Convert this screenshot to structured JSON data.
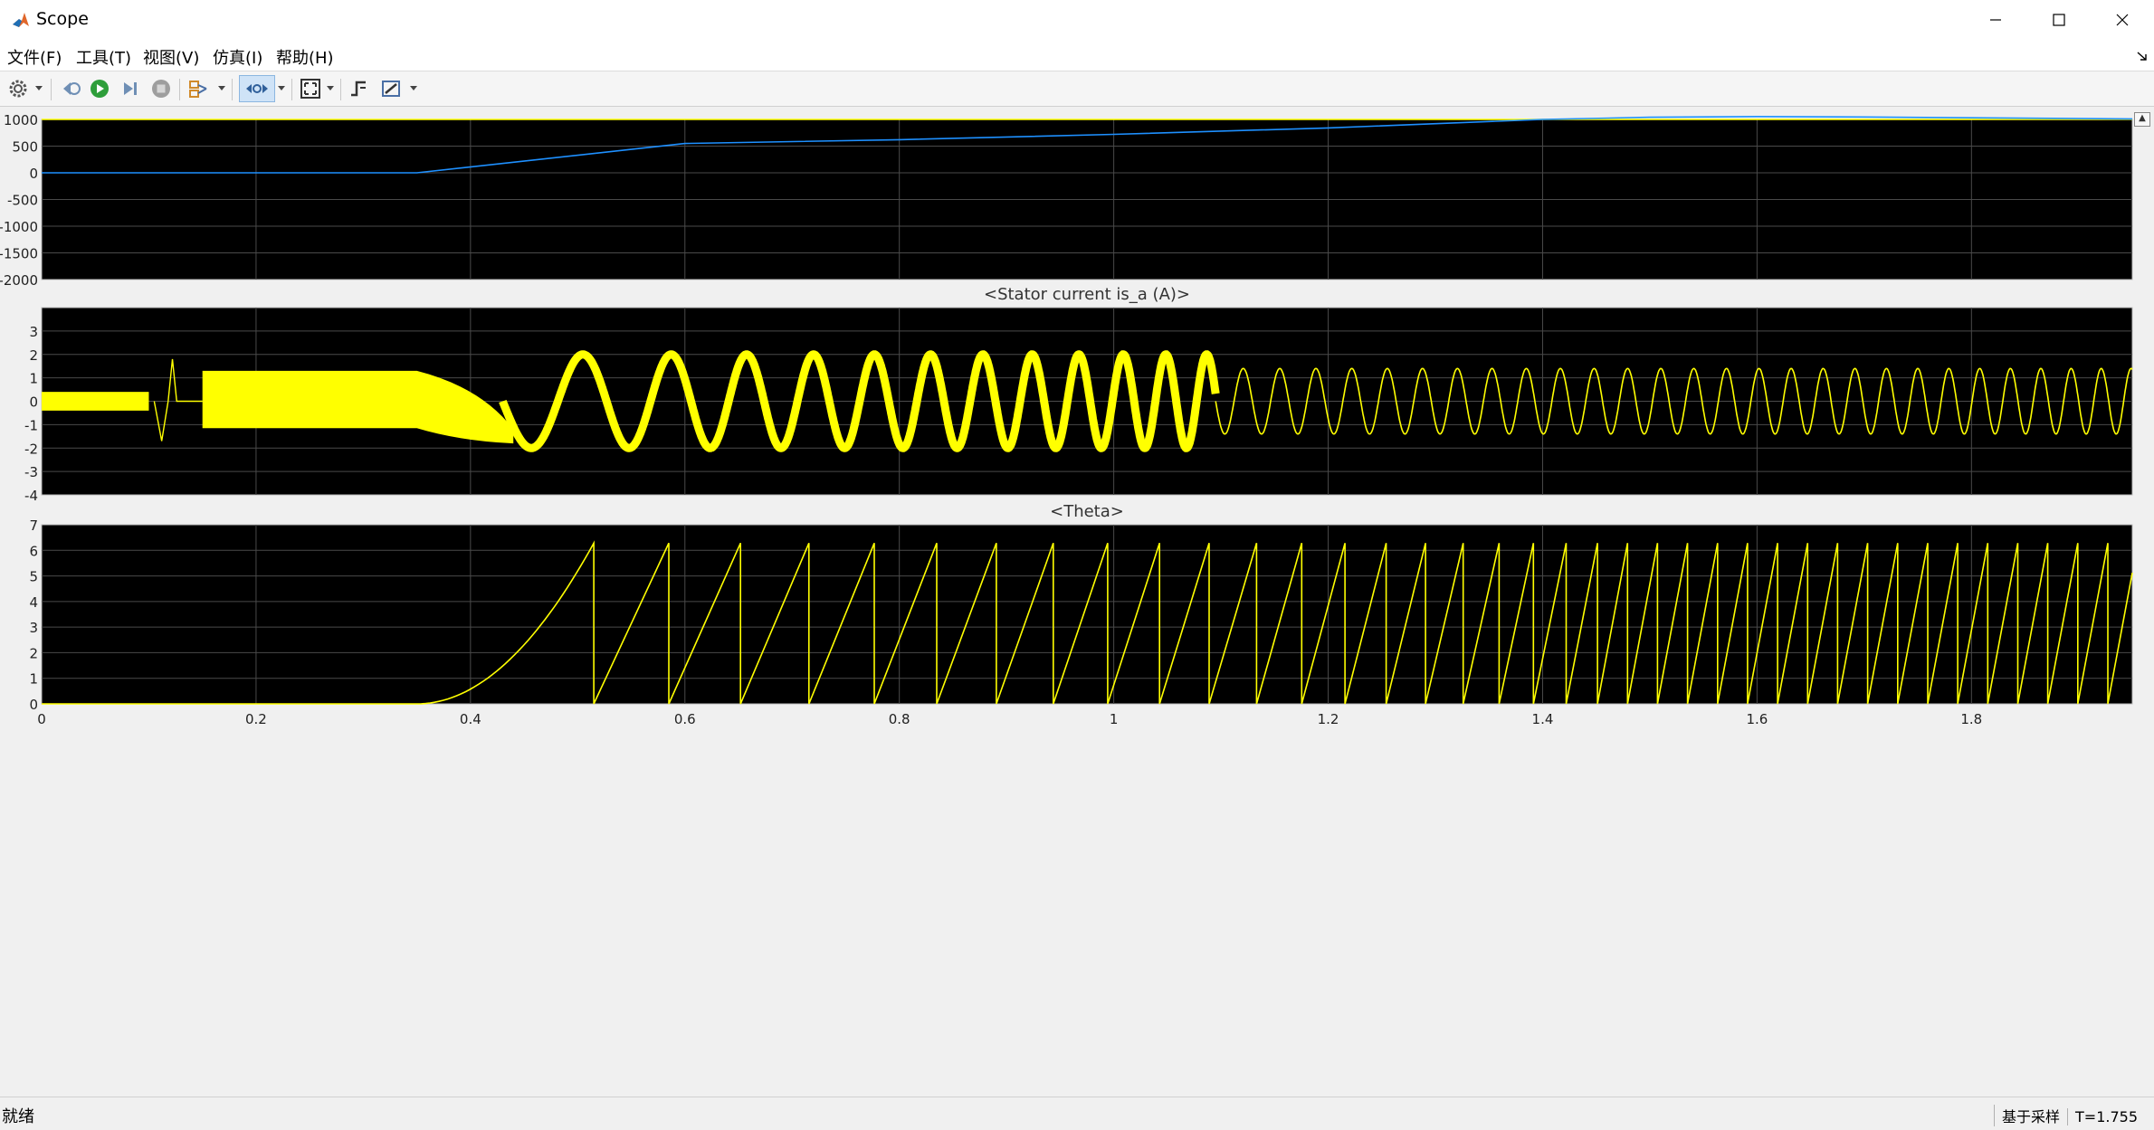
{
  "window": {
    "title": "Scope"
  },
  "menu": [
    "文件(F)",
    "工具(T)",
    "视图(V)",
    "仿真(I)",
    "帮助(H)"
  ],
  "toolbar_icons": [
    "settings-icon",
    "step-back-icon",
    "run-icon",
    "step-forward-icon",
    "stop-icon",
    "signal-select-icon",
    "zoom-icon",
    "autoscale-icon",
    "trigger-icon",
    "cursor-measure-icon"
  ],
  "status": {
    "left": "就绪",
    "sample_label": "基于采样",
    "time_label": "T=1.755"
  },
  "colors": {
    "plot_bg": "#000000",
    "grid": "#4a4a4a",
    "frame": "#bdbdbd",
    "tick_text": "#c9c9c9",
    "yellow": "#ffff00",
    "blue": "#1e90ff"
  },
  "chart_data": [
    {
      "type": "line",
      "title": "",
      "ylim": [
        -2000,
        1000
      ],
      "yticks": [
        1000,
        500,
        0,
        -500,
        -1000,
        -1500,
        -2000
      ],
      "xlim": [
        0,
        1.95
      ],
      "series": [
        {
          "color": "#ffff00",
          "x": [
            0,
            1.95
          ],
          "values": [
            1000,
            1000
          ]
        },
        {
          "color": "#1e90ff",
          "x": [
            0,
            0.35,
            0.6,
            0.8,
            1.0,
            1.2,
            1.4,
            1.5,
            1.6,
            1.7,
            1.8,
            1.95
          ],
          "values": [
            0,
            0,
            550,
            620,
            720,
            840,
            1000,
            1040,
            1055,
            1045,
            1030,
            1010
          ]
        }
      ]
    },
    {
      "type": "line",
      "title": "<Stator current is_a (A)>",
      "ylim": [
        -4,
        4
      ],
      "yticks": [
        3,
        2,
        1,
        0,
        -1,
        -2,
        -3,
        -4
      ],
      "xlim": [
        0,
        1.95
      ],
      "series": [
        {
          "color": "#ffff00",
          "description_free": true
        }
      ]
    },
    {
      "type": "line",
      "title": "<Theta>",
      "ylim": [
        0,
        7
      ],
      "yticks": [
        7,
        6,
        5,
        4,
        3,
        2,
        1,
        0
      ],
      "xlim": [
        0,
        1.95
      ],
      "xticks": [
        0,
        0.2,
        0.4,
        0.6,
        0.8,
        1,
        1.2,
        1.4,
        1.6,
        1.8
      ],
      "series": [
        {
          "color": "#ffff00"
        }
      ]
    }
  ]
}
